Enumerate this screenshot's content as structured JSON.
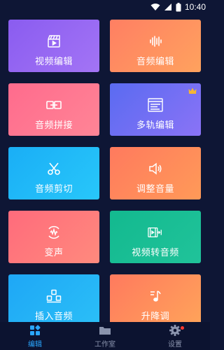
{
  "status_bar": {
    "time": "10:40"
  },
  "tiles": [
    {
      "label": "视频编辑",
      "icon": "clapperboard-icon",
      "gradient": [
        "#8a5cf0",
        "#a374f5"
      ]
    },
    {
      "label": "音频编辑",
      "icon": "waveform-icon",
      "gradient": [
        "#ff7f63",
        "#ffa25e"
      ]
    },
    {
      "label": "音频拼接",
      "icon": "link-icon",
      "gradient": [
        "#ff6b8d",
        "#ff8596"
      ]
    },
    {
      "label": "多轨编辑",
      "icon": "multitrack-icon",
      "gradient": [
        "#5a6bf1",
        "#8a73f6"
      ],
      "badge": "crown-icon"
    },
    {
      "label": "音频剪切",
      "icon": "scissors-icon",
      "gradient": [
        "#1aaef6",
        "#28c7fa"
      ]
    },
    {
      "label": "调整音量",
      "icon": "speaker-icon",
      "gradient": [
        "#ff7a5e",
        "#ff9a58"
      ]
    },
    {
      "label": "变声",
      "icon": "voice-change-icon",
      "gradient": [
        "#ff6b7c",
        "#ff8a7d"
      ]
    },
    {
      "label": "视频转音频",
      "icon": "video-to-audio-icon",
      "gradient": [
        "#13b98f",
        "#20c39a"
      ]
    },
    {
      "label": "插入音频",
      "icon": "insert-audio-icon",
      "gradient": [
        "#1ea7f6",
        "#2bbff7"
      ]
    },
    {
      "label": "升降调",
      "icon": "music-note-icon",
      "gradient": [
        "#ff7a5e",
        "#ffa45a"
      ]
    }
  ],
  "tabbar": {
    "tabs": [
      {
        "label": "编辑",
        "icon": "grid-icon",
        "active": true
      },
      {
        "label": "工作室",
        "icon": "folder-icon",
        "active": false
      },
      {
        "label": "设置",
        "icon": "gear-icon",
        "active": false,
        "badge": "red-dot"
      }
    ]
  },
  "colors": {
    "background": "#0e1635",
    "accent": "#2aa7ff",
    "inactive": "#8a93ad"
  }
}
